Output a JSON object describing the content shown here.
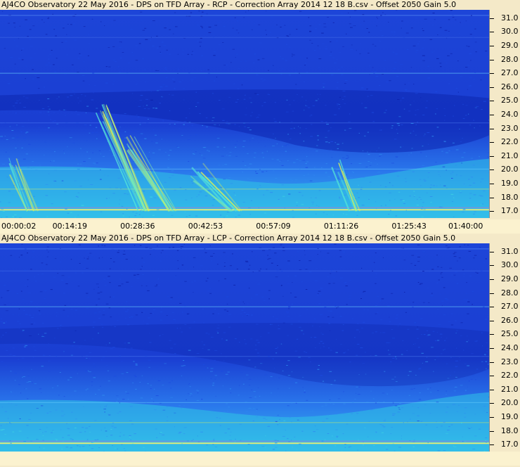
{
  "chart_data": [
    {
      "type": "heatmap",
      "title": "AJ4CO Observatory 22 May 2016  -  DPS on TFD Array  -  RCP  -  Correction Array 2014 12 18 B.csv  -  Offset 2050  Gain 5.0",
      "y_ticks": [
        "31.0",
        "30.0",
        "29.0",
        "28.0",
        "27.0",
        "26.0",
        "25.0",
        "24.0",
        "23.0",
        "22.0",
        "21.0",
        "20.0",
        "19.0",
        "18.0",
        "17.0"
      ],
      "x_ticks": [
        "00:00:02",
        "00:14:19",
        "00:28:36",
        "00:42:53",
        "00:57:09",
        "01:11:26",
        "01:25:43",
        "01:40:00"
      ],
      "ylim": [
        16.5,
        31.6
      ],
      "xlim": [
        "00:00:02",
        "01:40:00"
      ],
      "colormap": [
        "#0b1fa8",
        "#1c4ae0",
        "#2f8cf0",
        "#3fd6e0",
        "#c8f050"
      ]
    },
    {
      "type": "heatmap",
      "title": "AJ4CO Observatory 22 May 2016  -  DPS on TFD Array  -  LCP  -  Correction Array 2014 12 18 B.csv  -  Offset 2050  Gain 5.0",
      "y_ticks": [
        "31.0",
        "30.0",
        "29.0",
        "28.0",
        "27.0",
        "26.0",
        "25.0",
        "24.0",
        "23.0",
        "22.0",
        "21.0",
        "20.0",
        "19.0",
        "18.0",
        "17.0"
      ],
      "ylim": [
        16.5,
        31.6
      ],
      "xlim": [
        "00:00:02",
        "01:40:00"
      ],
      "colormap": [
        "#0b1fa8",
        "#1c4ae0",
        "#2f8cf0",
        "#3fd6e0",
        "#c8f050"
      ]
    }
  ]
}
